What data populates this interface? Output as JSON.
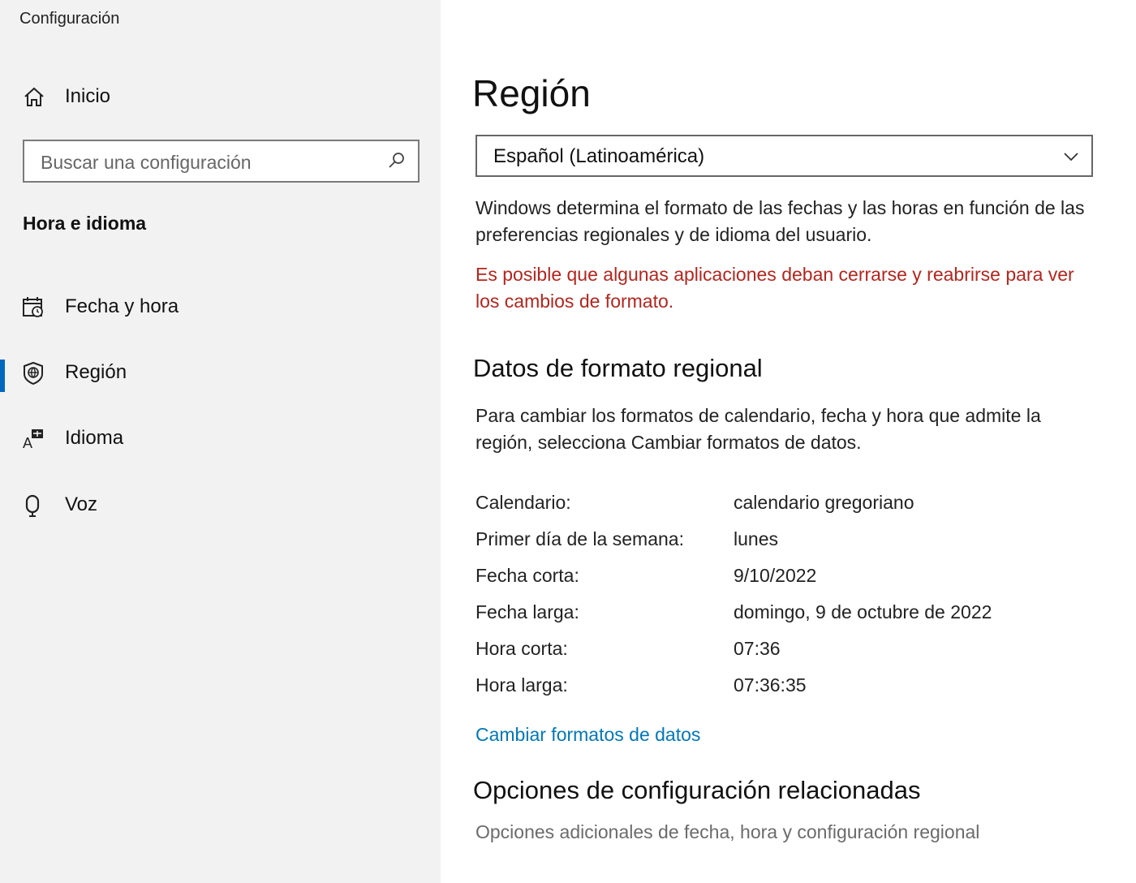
{
  "sidebar": {
    "app_title": "Configuración",
    "home_label": "Inicio",
    "search_placeholder": "Buscar una configuración",
    "section_header": "Hora e idioma",
    "items": [
      {
        "label": "Fecha y hora",
        "icon": "calendar-clock-icon",
        "selected": false
      },
      {
        "label": "Región",
        "icon": "region-globe-icon",
        "selected": true
      },
      {
        "label": "Idioma",
        "icon": "language-icon",
        "selected": false
      },
      {
        "label": "Voz",
        "icon": "microphone-icon",
        "selected": false
      }
    ]
  },
  "main": {
    "title": "Región",
    "region_select": {
      "value": "Español (Latinoamérica)"
    },
    "description": "Windows determina el formato de las fechas y las horas en función de las preferencias regionales y de idioma del usuario.",
    "warning": "Es posible que algunas aplicaciones deban cerrarse y reabrirse para ver los cambios de formato.",
    "regional_format": {
      "heading": "Datos de formato regional",
      "description": "Para cambiar los formatos de calendario, fecha y hora que admite la región, selecciona Cambiar formatos de datos.",
      "rows": [
        {
          "key": "Calendario:",
          "value": "calendario gregoriano"
        },
        {
          "key": "Primer día de la semana:",
          "value": "lunes"
        },
        {
          "key": "Fecha corta:",
          "value": "9/10/2022"
        },
        {
          "key": "Fecha larga:",
          "value": "domingo, 9 de octubre de 2022"
        },
        {
          "key": "Hora corta:",
          "value": "07:36"
        },
        {
          "key": "Hora larga:",
          "value": "07:36:35"
        }
      ],
      "change_link": "Cambiar formatos de datos"
    },
    "related": {
      "heading": "Opciones de configuración relacionadas",
      "link": "Opciones adicionales de fecha, hora y configuración regional"
    }
  },
  "colors": {
    "sidebar_bg": "#f2f2f2",
    "accent": "#0067c0",
    "warning": "#b3261e",
    "link": "#0078b8"
  }
}
